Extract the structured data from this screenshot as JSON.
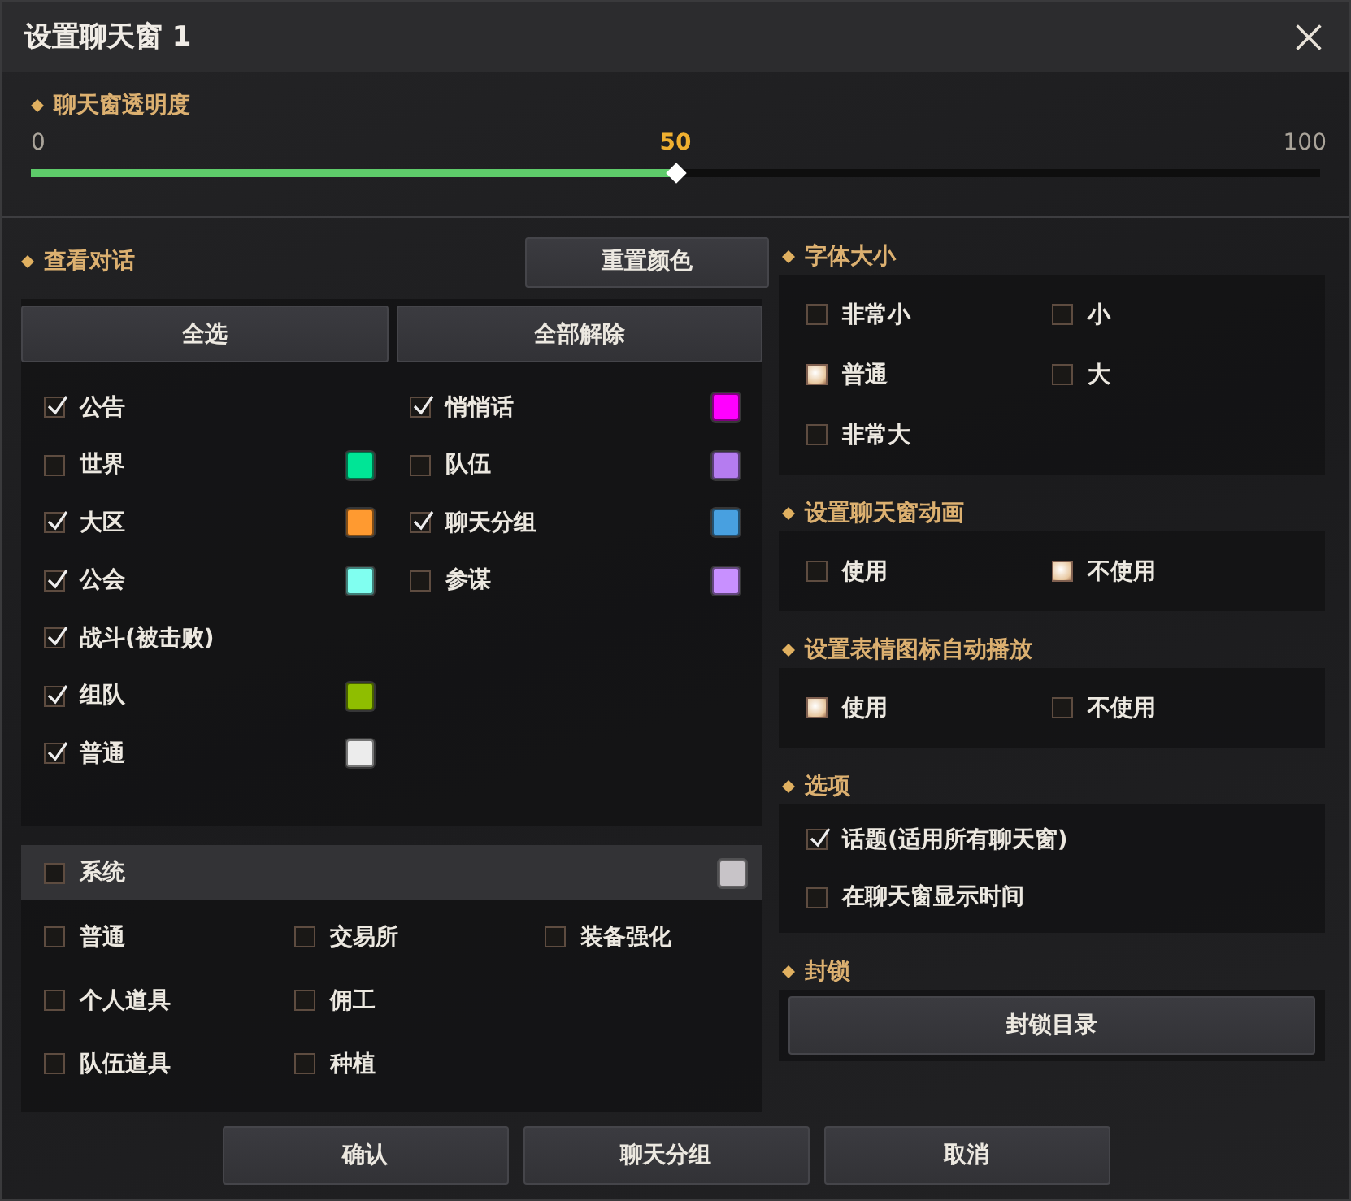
{
  "window": {
    "title": "设置聊天窗 1"
  },
  "opacity": {
    "label": "聊天窗透明度",
    "min": "0",
    "value": "50",
    "max": "100",
    "level": 0.5
  },
  "chat_view": {
    "label": "查看对话",
    "reset_button": "重置颜色",
    "select_all": "全选",
    "clear_all": "全部解除",
    "columns": [
      [
        {
          "label": "公告",
          "checked": true
        },
        {
          "label": "世界",
          "checked": false,
          "color": "#00e596"
        },
        {
          "label": "大区",
          "checked": true,
          "color": "#ff9a30"
        },
        {
          "label": "公会",
          "checked": true,
          "color": "#80fff0"
        },
        {
          "label": "战斗(被击败)",
          "checked": true
        },
        {
          "label": "组队",
          "checked": true,
          "color": "#8fbe00"
        },
        {
          "label": "普通",
          "checked": true,
          "color": "#ececec"
        }
      ],
      [
        {
          "label": "悄悄话",
          "checked": true,
          "color": "#ff00ff"
        },
        {
          "label": "队伍",
          "checked": false,
          "color": "#b57cf0"
        },
        {
          "label": "聊天分组",
          "checked": true,
          "color": "#48a0e0"
        },
        {
          "label": "参谋",
          "checked": false,
          "color": "#c890ff"
        }
      ]
    ]
  },
  "system": {
    "label": "系统",
    "checked": false,
    "color": "#c8c4c8",
    "items": [
      {
        "label": "普通",
        "checked": false
      },
      {
        "label": "个人道具",
        "checked": false
      },
      {
        "label": "队伍道具",
        "checked": false
      },
      {
        "label": "交易所",
        "checked": false
      },
      {
        "label": "佣工",
        "checked": false
      },
      {
        "label": "种植",
        "checked": false
      },
      {
        "label": "装备强化",
        "checked": false
      }
    ]
  },
  "font_size": {
    "label": "字体大小",
    "options": [
      {
        "label": "非常小",
        "selected": false
      },
      {
        "label": "小",
        "selected": false
      },
      {
        "label": "普通",
        "selected": true
      },
      {
        "label": "大",
        "selected": false
      },
      {
        "label": "非常大",
        "selected": false
      }
    ]
  },
  "animation": {
    "label": "设置聊天窗动画",
    "options": [
      {
        "label": "使用",
        "selected": false
      },
      {
        "label": "不使用",
        "selected": true
      }
    ]
  },
  "emoji_autoplay": {
    "label": "设置表情图标自动播放",
    "options": [
      {
        "label": "使用",
        "selected": true
      },
      {
        "label": "不使用",
        "selected": false
      }
    ]
  },
  "options": {
    "label": "选项",
    "items": [
      {
        "label": "话题(适用所有聊天窗)",
        "checked": true
      },
      {
        "label": "在聊天窗显示时间",
        "checked": false
      }
    ]
  },
  "block": {
    "label": "封锁",
    "button": "封锁目录"
  },
  "buttons": [
    "确认",
    "聊天分组",
    "取消"
  ]
}
